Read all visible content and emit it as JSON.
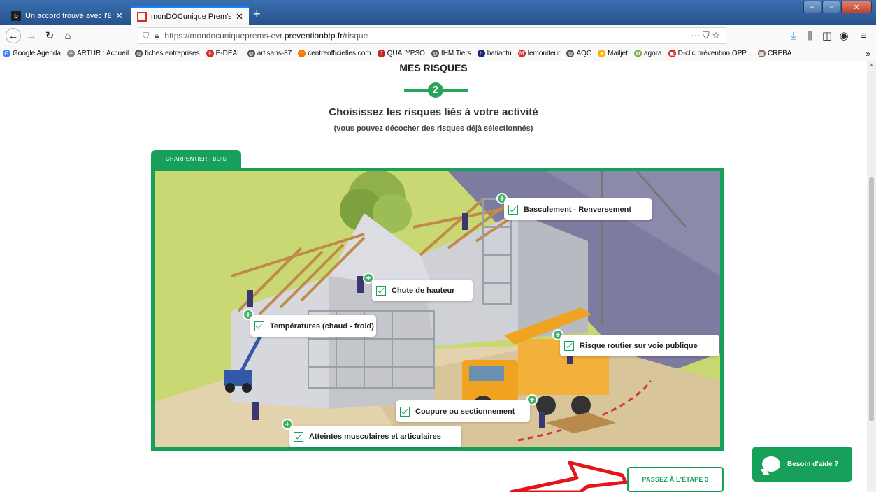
{
  "browser": {
    "tabs": [
      {
        "title": "Un accord trouvé avec l'Etat po",
        "favicon": "b",
        "favicon_color": "#1e1e1e",
        "active": false
      },
      {
        "title": "monDOCunique Prem's",
        "favicon": "",
        "favicon_color": "#d62b2b",
        "active": true
      }
    ],
    "url_prefix": "https://mondocuniqueprems-evr.",
    "url_domain": "preventionbtp.fr",
    "url_path": "/risque",
    "url_actions": "··· ⛉ ☆",
    "bookmarks": [
      {
        "label": "Google Agenda",
        "icon": "G",
        "color": "#4285f4"
      },
      {
        "label": "ARTUR : Accueil",
        "icon": "✈",
        "color": "#888888"
      },
      {
        "label": "fiches entreprises",
        "icon": "◍",
        "color": "#555555"
      },
      {
        "label": "E-DEAL",
        "icon": "✈",
        "color": "#d32f2f"
      },
      {
        "label": "artisans-87",
        "icon": "◍",
        "color": "#555555"
      },
      {
        "label": "centreofficielles.com",
        "icon": "c",
        "color": "#f57c00"
      },
      {
        "label": "QUALYPSO",
        "icon": "J",
        "color": "#c62828"
      },
      {
        "label": "IHM Tiers",
        "icon": "◍",
        "color": "#555555"
      },
      {
        "label": "batiactu",
        "icon": "b",
        "color": "#1a237e"
      },
      {
        "label": "lemoniteur",
        "icon": "M",
        "color": "#d32f2f"
      },
      {
        "label": "AQC",
        "icon": "◍",
        "color": "#555555"
      },
      {
        "label": "Mailjet",
        "icon": "➤",
        "color": "#ffb300"
      },
      {
        "label": "agora",
        "icon": "✿",
        "color": "#7cb342"
      },
      {
        "label": "D-clic prévention OPP...",
        "icon": "▣",
        "color": "#d32f2f"
      },
      {
        "label": "CREBA",
        "icon": "▦",
        "color": "#8d6e63"
      }
    ]
  },
  "page": {
    "step_title": "MES RISQUES",
    "step_number": "2",
    "heading": "Choisissez les risques liés à votre activité",
    "subheading": "(vous pouvez décocher des risques déjà sélectionnés)",
    "job_tab": "CHARPENTIER - BOIS",
    "risks": [
      {
        "label": "Basculement - Renversement",
        "checked": true
      },
      {
        "label": "Chute de hauteur",
        "checked": true
      },
      {
        "label": "Températures (chaud - froid)",
        "checked": true
      },
      {
        "label": "Risque routier sur voie publique",
        "checked": true
      },
      {
        "label": "Coupure ou sectionnement",
        "checked": true
      },
      {
        "label": "Atteintes musculaires et articulaires",
        "checked": true
      }
    ],
    "next_button": "PASSEZ À L'ÉTAPE 3",
    "help_button": "Besoin d'aide ?"
  },
  "colors": {
    "accent_green": "#17a05a",
    "arrow_red": "#e4141b"
  }
}
